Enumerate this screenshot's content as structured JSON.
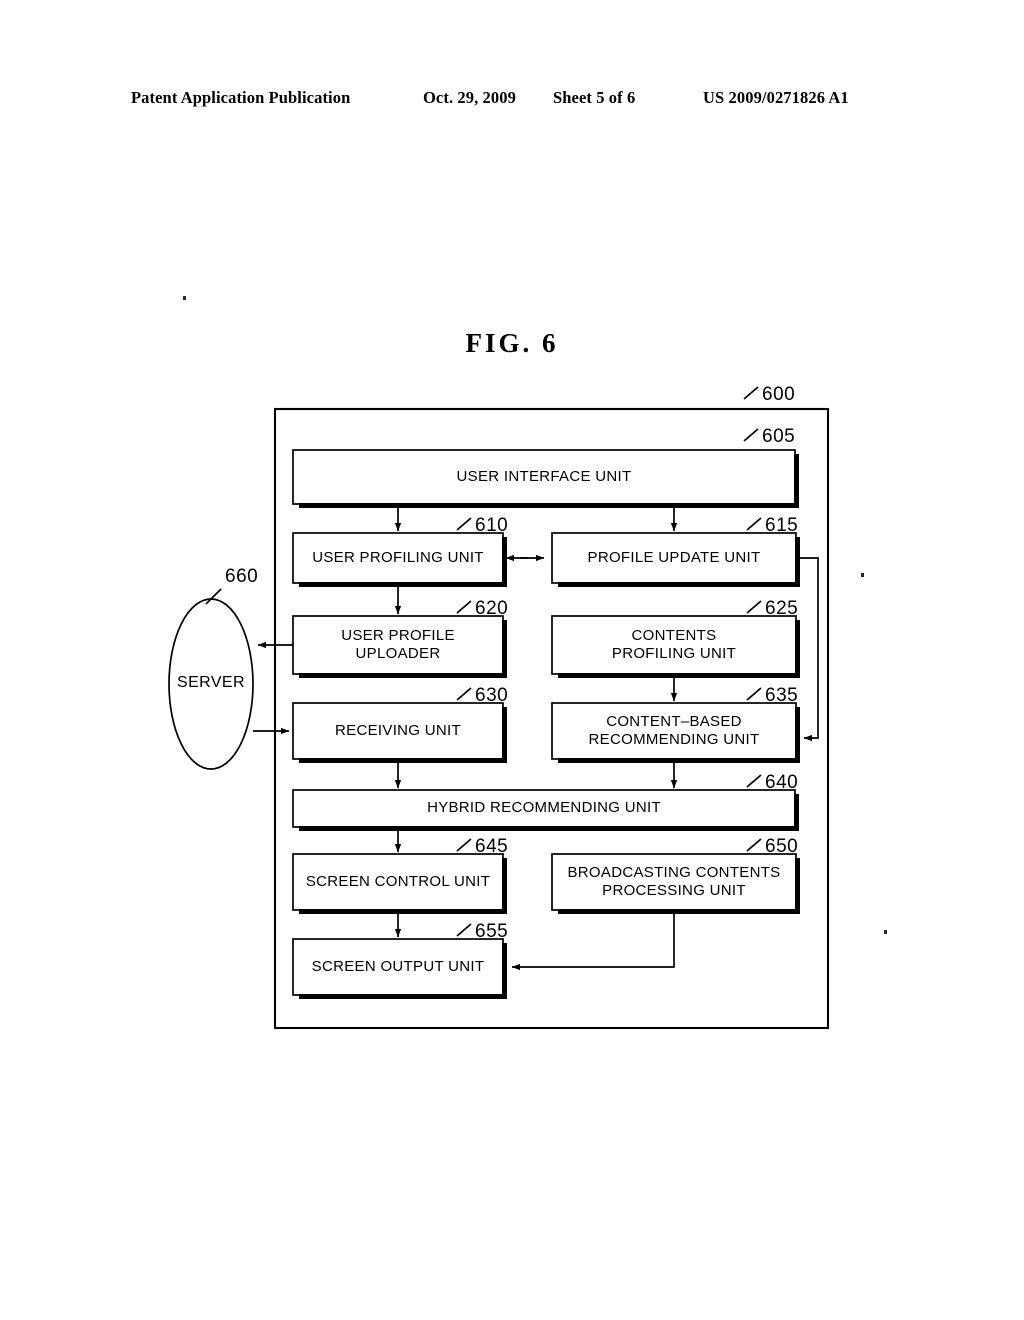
{
  "header": {
    "publication": "Patent Application Publication",
    "date": "Oct. 29, 2009",
    "sheet": "Sheet 5 of 6",
    "patent_number": "US 2009/0271826 A1"
  },
  "figure": {
    "title": "FIG.  6",
    "outer_ref": "600",
    "server": {
      "label": "SERVER",
      "ref": "660"
    },
    "blocks": [
      {
        "id": "user-interface-unit",
        "ref": "605",
        "label": "USER INTERFACE UNIT"
      },
      {
        "id": "user-profiling-unit",
        "ref": "610",
        "label": "USER PROFILING UNIT"
      },
      {
        "id": "profile-update-unit",
        "ref": "615",
        "label": "PROFILE UPDATE UNIT"
      },
      {
        "id": "user-profile-uploader",
        "ref": "620",
        "label": "USER PROFILE\nUPLOADER"
      },
      {
        "id": "contents-profiling-unit",
        "ref": "625",
        "label": "CONTENTS\nPROFILING UNIT"
      },
      {
        "id": "receiving-unit",
        "ref": "630",
        "label": "RECEIVING UNIT"
      },
      {
        "id": "content-based-recommending-unit",
        "ref": "635",
        "label": "CONTENT–BASED\nRECOMMENDING UNIT"
      },
      {
        "id": "hybrid-recommending-unit",
        "ref": "640",
        "label": "HYBRID RECOMMENDING UNIT"
      },
      {
        "id": "screen-control-unit",
        "ref": "645",
        "label": "SCREEN CONTROL UNIT"
      },
      {
        "id": "broadcasting-contents-processing-unit",
        "ref": "650",
        "label": "BROADCASTING CONTENTS\nPROCESSING UNIT"
      },
      {
        "id": "screen-output-unit",
        "ref": "655",
        "label": "SCREEN OUTPUT UNIT"
      }
    ],
    "connections": [
      {
        "from": "user-interface-unit",
        "to": "user-profiling-unit",
        "type": "arrow-down"
      },
      {
        "from": "user-interface-unit",
        "to": "profile-update-unit",
        "type": "arrow-down"
      },
      {
        "from": "user-profiling-unit",
        "to": "profile-update-unit",
        "type": "arrow-bidirectional"
      },
      {
        "from": "user-profiling-unit",
        "to": "user-profile-uploader",
        "type": "arrow-down"
      },
      {
        "from": "user-profile-uploader",
        "to": "server",
        "type": "arrow-left"
      },
      {
        "from": "server",
        "to": "receiving-unit",
        "type": "arrow-right"
      },
      {
        "from": "contents-profiling-unit",
        "to": "content-based-recommending-unit",
        "type": "arrow-down"
      },
      {
        "from": "profile-update-unit",
        "to": "content-based-recommending-unit",
        "type": "arrow-routed-right"
      },
      {
        "from": "receiving-unit",
        "to": "hybrid-recommending-unit",
        "type": "arrow-down"
      },
      {
        "from": "content-based-recommending-unit",
        "to": "hybrid-recommending-unit",
        "type": "arrow-down"
      },
      {
        "from": "hybrid-recommending-unit",
        "to": "screen-control-unit",
        "type": "arrow-down"
      },
      {
        "from": "screen-control-unit",
        "to": "screen-output-unit",
        "type": "arrow-down"
      },
      {
        "from": "broadcasting-contents-processing-unit",
        "to": "screen-output-unit",
        "type": "arrow-routed-left"
      }
    ]
  }
}
